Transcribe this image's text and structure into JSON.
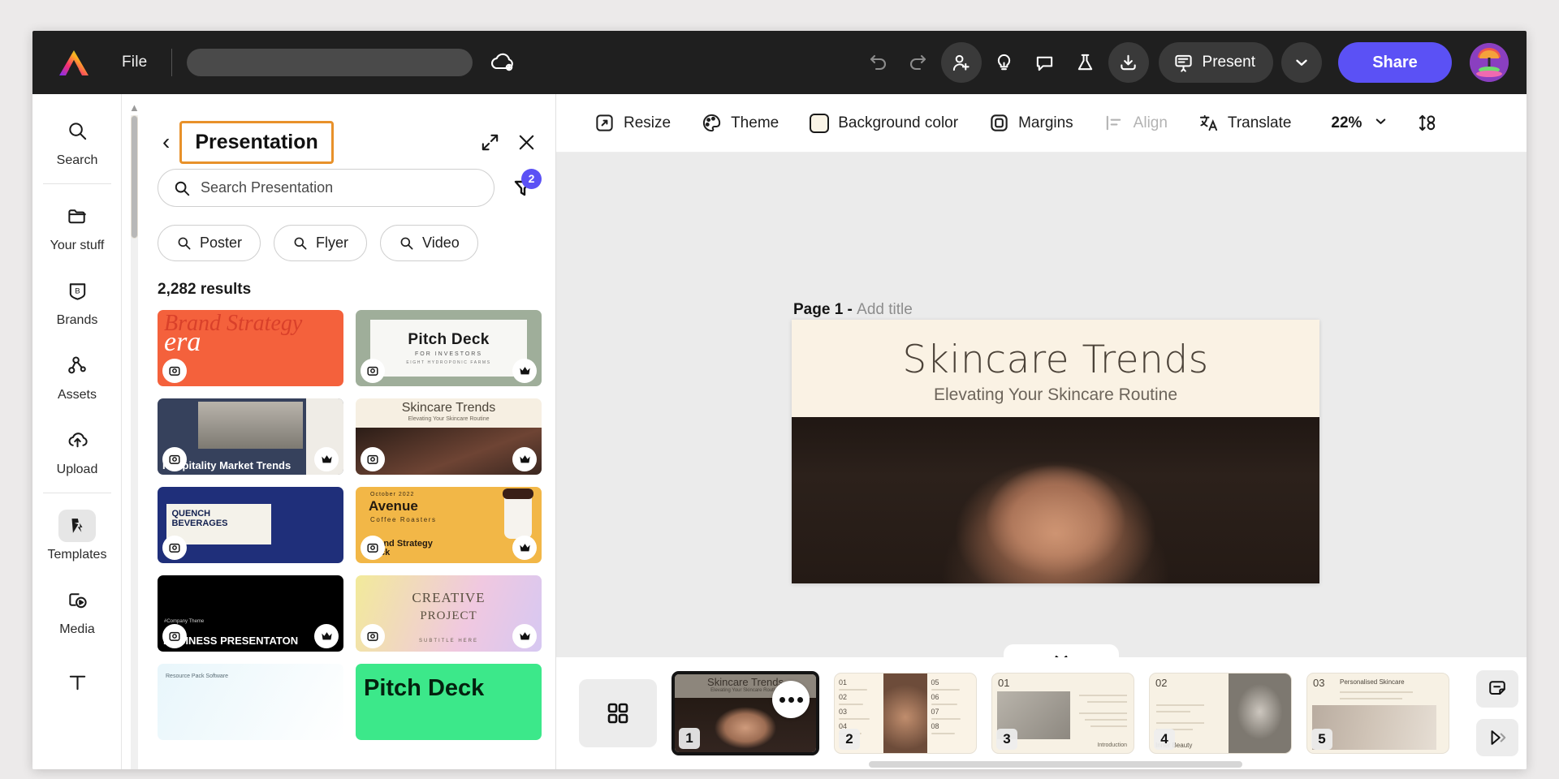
{
  "topbar": {
    "logo_icon": "adobe-express-logo",
    "file_label": "File",
    "title_value": "",
    "title_placeholder": "",
    "cloud_icon": "cloud-sync-icon",
    "undo_icon": "undo-icon",
    "redo_icon": "redo-icon",
    "invite_icon": "add-person-icon",
    "ideas_icon": "lightbulb-icon",
    "comment_icon": "comment-icon",
    "labs_icon": "flask-icon",
    "download_icon": "download-icon",
    "present_icon": "presentation-icon",
    "present_label": "Present",
    "present_caret_icon": "chevron-down-icon",
    "share_label": "Share",
    "avatar_icon": "user-avatar",
    "accent_color": "#5b51f5"
  },
  "rail": {
    "items": [
      {
        "label": "Search",
        "icon": "search-icon",
        "active": false
      },
      {
        "label": "Your stuff",
        "icon": "folder-icon",
        "active": false
      },
      {
        "label": "Brands",
        "icon": "brand-shield-icon",
        "active": false
      },
      {
        "label": "Assets",
        "icon": "assets-node-icon",
        "active": false
      },
      {
        "label": "Upload",
        "icon": "cloud-upload-icon",
        "active": false
      },
      {
        "label": "Templates",
        "icon": "templates-icon",
        "active": true
      },
      {
        "label": "Media",
        "icon": "media-play-icon",
        "active": false
      },
      {
        "label": "",
        "icon": "text-tool-icon",
        "active": false
      }
    ]
  },
  "panel": {
    "back_icon": "chevron-left-icon",
    "title": "Presentation",
    "highlight_color": "#e8912a",
    "expand_icon": "expand-diagonal-icon",
    "close_icon": "close-icon",
    "search": {
      "icon": "search-icon",
      "value": "",
      "placeholder": "Search Presentation"
    },
    "filter": {
      "icon": "filter-funnel-icon",
      "badge": "2"
    },
    "chips": [
      {
        "label": "Poster",
        "icon": "search-icon"
      },
      {
        "label": "Flyer",
        "icon": "search-icon"
      },
      {
        "label": "Video",
        "icon": "search-icon"
      }
    ],
    "results_count": "2,282 results",
    "templates": [
      {
        "id": "c1",
        "title": "Brand Strategy",
        "subtitle": "era",
        "premium": false,
        "image_badge": true
      },
      {
        "id": "c2",
        "title": "Pitch Deck",
        "subtitle": "FOR INVESTORS",
        "subtitle2": "EIGHT HYDROPONIC FARMS",
        "premium": true,
        "image_badge": true
      },
      {
        "id": "c3",
        "title": "Hospitality Market Trends",
        "premium": true,
        "image_badge": true
      },
      {
        "id": "c4",
        "title": "Skincare Trends",
        "subtitle": "Elevating Your Skincare Routine",
        "premium": true,
        "image_badge": true
      },
      {
        "id": "c5",
        "title": "QUENCH BEVERAGES",
        "premium": false,
        "image_badge": true
      },
      {
        "id": "c6",
        "title": "Avenue",
        "subtitle": "Coffee Roasters",
        "date": "October 2022",
        "caption": "Brand Strategy Deck",
        "premium": true,
        "image_badge": true
      },
      {
        "id": "c7",
        "title": "BUSINESS PRESENTATON",
        "subtitle": "#Company Theme",
        "premium": true,
        "image_badge": true
      },
      {
        "id": "c8",
        "title": "CREATIVE",
        "subtitle": "PROJECT",
        "caption": "SUBTITLE HERE",
        "premium": true,
        "image_badge": true
      },
      {
        "id": "c9",
        "title": "Resource Pack Software",
        "premium": false,
        "image_badge": false
      },
      {
        "id": "c10",
        "title": "Pitch Deck",
        "premium": false,
        "image_badge": false
      }
    ]
  },
  "canvas": {
    "toolbar": [
      {
        "label": "Resize",
        "icon": "resize-icon",
        "disabled": false
      },
      {
        "label": "Theme",
        "icon": "palette-icon",
        "disabled": false
      },
      {
        "label": "Background color",
        "icon": "color-swatch-icon",
        "disabled": false,
        "swatch": "#faf4e6"
      },
      {
        "label": "Margins",
        "icon": "margins-icon",
        "disabled": false
      },
      {
        "label": "Align",
        "icon": "align-icon",
        "disabled": true
      },
      {
        "label": "Translate",
        "icon": "translate-icon",
        "disabled": false
      }
    ],
    "zoom_value": "22%",
    "zoom_caret_icon": "chevron-down-icon",
    "fit_icon": "fit-to-screen-icon",
    "page_label": "Page 1 - ",
    "page_title_placeholder": "Add title",
    "slide": {
      "title": "Skincare Trends",
      "subtitle": "Elevating Your Skincare Routine",
      "background": "#faf2e4"
    }
  },
  "filmstrip": {
    "collapse_icon": "chevron-down-icon",
    "grid_view_icon": "grid-view-icon",
    "more_icon": "more-dots-icon",
    "slides": [
      {
        "number": "1",
        "title": "Skincare Trends",
        "subtitle": "Elevating Your Skincare Routine",
        "selected": true
      },
      {
        "number": "2",
        "items": [
          "01",
          "02",
          "03",
          "04",
          "05",
          "06",
          "07",
          "08"
        ],
        "selected": false
      },
      {
        "number": "3",
        "section": "01",
        "caption": "Introduction",
        "selected": false
      },
      {
        "number": "4",
        "section": "02",
        "caption": "Inner Beauty",
        "selected": false
      },
      {
        "number": "5",
        "section": "03",
        "caption": "Personalised Skincare",
        "selected": false
      }
    ],
    "notes_icon": "sticky-note-icon",
    "play_icon": "play-skip-icon"
  }
}
